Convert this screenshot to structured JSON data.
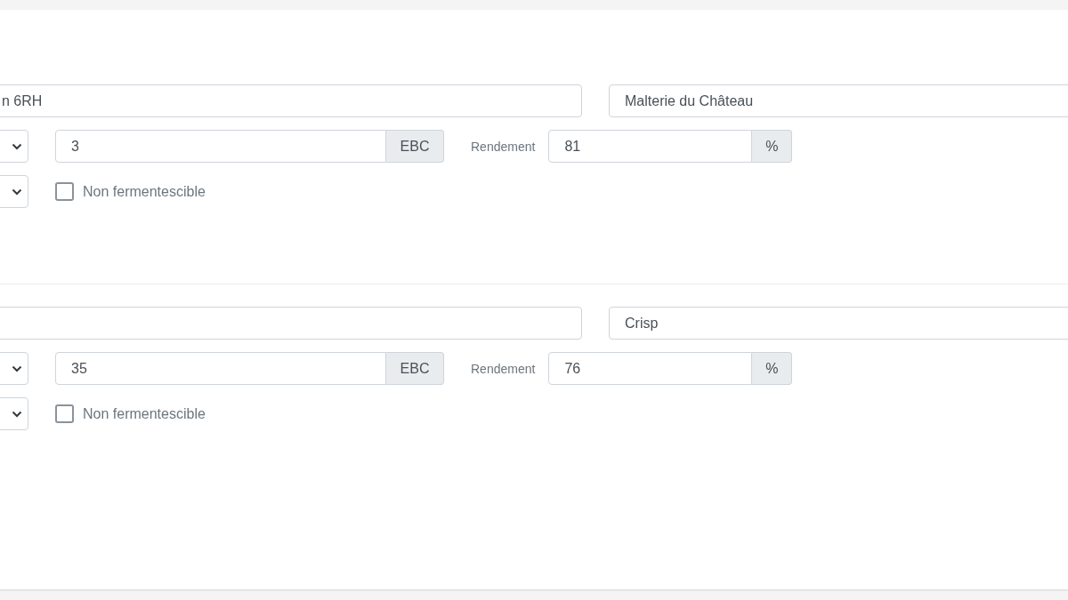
{
  "ingredients": [
    {
      "name": "n 6RH",
      "supplier": "Malterie du Château",
      "color": {
        "value": "3",
        "unit": "EBC"
      },
      "yield": {
        "label": "Rendement",
        "value": "81",
        "unit": "%"
      },
      "non_fermentable": {
        "label": "Non fermentescible",
        "checked": false
      }
    },
    {
      "supplier": "Crisp",
      "color": {
        "value": "35",
        "unit": "EBC"
      },
      "yield": {
        "label": "Rendement",
        "value": "76",
        "unit": "%"
      },
      "non_fermentable": {
        "label": "Non fermentescible",
        "checked": false
      }
    }
  ]
}
